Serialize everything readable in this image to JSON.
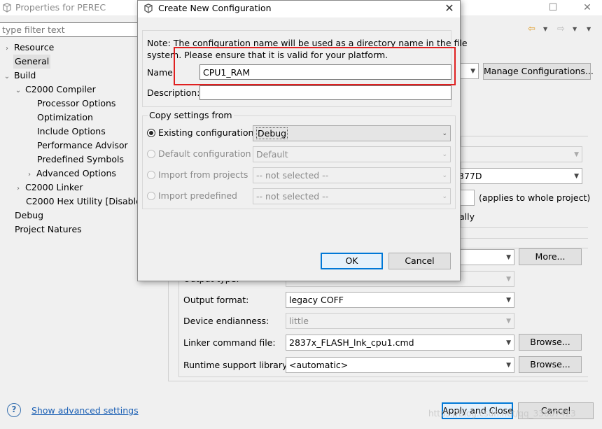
{
  "background_window": {
    "title": "Properties for PEREC",
    "filter_placeholder": "type filter text",
    "tree": {
      "resource": "Resource",
      "general": "General",
      "build": "Build",
      "c2000_compiler": "C2000 Compiler",
      "processor_options": "Processor Options",
      "optimization": "Optimization",
      "include_options": "Include Options",
      "performance_advisor": "Performance Advisor",
      "predefined_symbols": "Predefined Symbols",
      "advanced_options": "Advanced Options",
      "c2000_linker": "C2000 Linker",
      "c2000_hex_utility": "C2000 Hex Utility  [Disabled]",
      "debug": "Debug",
      "project_natures": "Project Natures"
    },
    "manage_configurations_label": "Manage Configurations...",
    "device_fragment": "377D",
    "applies_label": "(applies to whole project)",
    "ally_fragment": "ally",
    "more_label": "More...",
    "output_type_label": "Output type:",
    "output_format_label": "Output format:",
    "output_format_value": "legacy COFF",
    "device_endianness_label": "Device endianness:",
    "device_endianness_value": "little",
    "linker_command_label": "Linker command file:",
    "linker_command_value": "2837x_FLASH_lnk_cpu1.cmd",
    "runtime_library_label": "Runtime support library:",
    "runtime_library_value": "<automatic>",
    "browse_label": "Browse...",
    "show_advanced": "Show advanced settings",
    "apply_close_label": "Apply and Close",
    "cancel_label": "Cancel",
    "help_glyph": "?",
    "watermark": "https://blog.csdn.net/qq_33607423"
  },
  "dialog": {
    "title": "Create New Configuration",
    "note_line1": "Note: The configuration name will be used as a directory name in the file",
    "note_line2": "system.  Please ensure that it is valid for your platform.",
    "name_label": "Name",
    "name_value": "CPU1_RAM",
    "description_label": "Description:",
    "description_value": "",
    "copy_settings_legend": "Copy settings from",
    "options": [
      {
        "label": "Existing configuration",
        "value": "Debug",
        "checked": true,
        "enabled": true
      },
      {
        "label": "Default configuration",
        "value": "Default",
        "checked": false,
        "enabled": false
      },
      {
        "label": "Import from projects",
        "value": "-- not selected --",
        "checked": false,
        "enabled": false
      },
      {
        "label": "Import predefined",
        "value": "-- not selected --",
        "checked": false,
        "enabled": false
      }
    ],
    "ok_label": "OK",
    "cancel_label": "Cancel"
  },
  "colors": {
    "highlight_box": "#e02020",
    "link": "#1a5fb4",
    "focus_border": "#0078d7"
  }
}
